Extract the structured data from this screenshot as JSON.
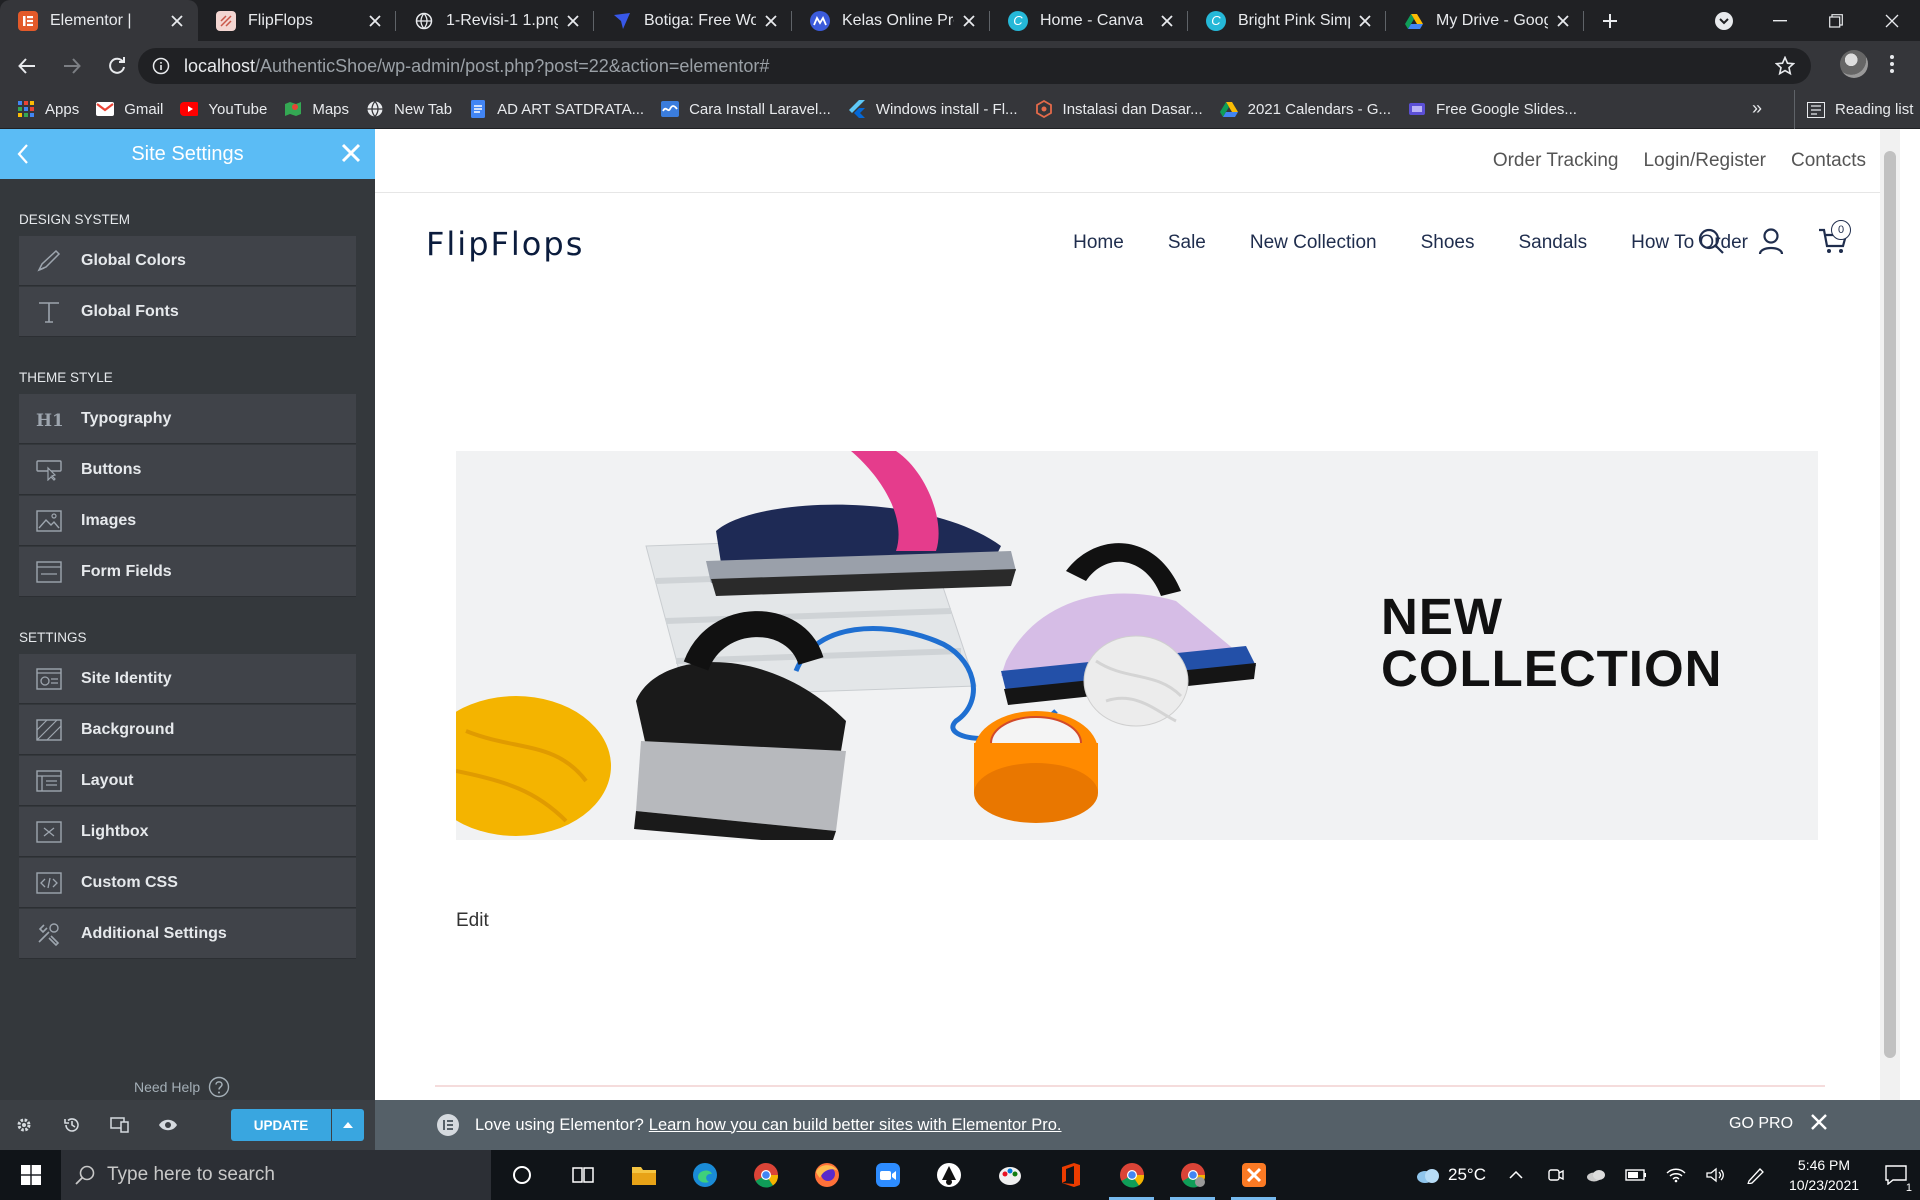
{
  "browser": {
    "tabs": [
      {
        "title": "Elementor |",
        "icon": "elementor-icon",
        "active": true
      },
      {
        "title": "FlipFlops",
        "icon": "flipflops-favicon"
      },
      {
        "title": "1-Revisi-1 1.png (",
        "icon": "globe-icon"
      },
      {
        "title": "Botiga: Free Wooc",
        "icon": "botiga-icon"
      },
      {
        "title": "Kelas Online Prem",
        "icon": "kelas-icon"
      },
      {
        "title": "Home - Canva",
        "icon": "canva-icon"
      },
      {
        "title": "Bright Pink Simple",
        "icon": "canva-icon"
      },
      {
        "title": "My Drive - Googl",
        "icon": "drive-icon"
      }
    ],
    "url_host": "localhost",
    "url_path": "/AuthenticShoe/wp-admin/post.php?post=22&action=elementor#",
    "bookmarks": [
      {
        "label": "Apps",
        "icon": "apps-grid-icon"
      },
      {
        "label": "Gmail",
        "icon": "gmail-icon"
      },
      {
        "label": "YouTube",
        "icon": "youtube-icon"
      },
      {
        "label": "Maps",
        "icon": "maps-icon"
      },
      {
        "label": "New Tab",
        "icon": "globe-icon"
      },
      {
        "label": "AD ART SATDRATA...",
        "icon": "docs-icon"
      },
      {
        "label": "Cara Install Laravel...",
        "icon": "laravel-icon"
      },
      {
        "label": "Windows install - Fl...",
        "icon": "flutter-icon"
      },
      {
        "label": "Instalasi dan Dasar...",
        "icon": "instalasi-icon"
      },
      {
        "label": "2021 Calendars - G...",
        "icon": "drive-icon"
      },
      {
        "label": "Free Google Slides...",
        "icon": "slides-icon"
      }
    ],
    "bookmarks_more": "»",
    "reading_list": "Reading list"
  },
  "panel": {
    "title": "Site Settings",
    "sections": [
      {
        "heading": "DESIGN SYSTEM",
        "items": [
          {
            "label": "Global Colors",
            "icon": "brush-icon"
          },
          {
            "label": "Global Fonts",
            "icon": "font-t-icon"
          }
        ]
      },
      {
        "heading": "THEME STYLE",
        "items": [
          {
            "label": "Typography",
            "icon": "h1-icon"
          },
          {
            "label": "Buttons",
            "icon": "button-cursor-icon"
          },
          {
            "label": "Images",
            "icon": "image-icon"
          },
          {
            "label": "Form Fields",
            "icon": "form-field-icon"
          }
        ]
      },
      {
        "heading": "SETTINGS",
        "items": [
          {
            "label": "Site Identity",
            "icon": "site-identity-icon"
          },
          {
            "label": "Background",
            "icon": "background-icon"
          },
          {
            "label": "Layout",
            "icon": "layout-icon"
          },
          {
            "label": "Lightbox",
            "icon": "lightbox-icon"
          },
          {
            "label": "Custom CSS",
            "icon": "code-icon"
          },
          {
            "label": "Additional Settings",
            "icon": "tools-icon"
          }
        ]
      }
    ],
    "need_help": "Need Help",
    "update_label": "UPDATE"
  },
  "site": {
    "top_links": [
      "Order Tracking",
      "Login/Register",
      "Contacts"
    ],
    "logo": "FlipFlops",
    "nav": [
      "Home",
      "Sale",
      "New Collection",
      "Shoes",
      "Sandals",
      "How To Order"
    ],
    "cart_count": "0",
    "banner_title_1": "NEW",
    "banner_title_2": "COLLECTION",
    "edit_link": "Edit"
  },
  "promo": {
    "text": "Love using Elementor?",
    "link": "Learn how you can build better sites with Elementor Pro.",
    "go_pro": "GO PRO"
  },
  "taskbar": {
    "search_placeholder": "Type here to search",
    "weather": "25°C",
    "time": "5:46 PM",
    "date": "10/23/2021",
    "notification_count": "1"
  }
}
